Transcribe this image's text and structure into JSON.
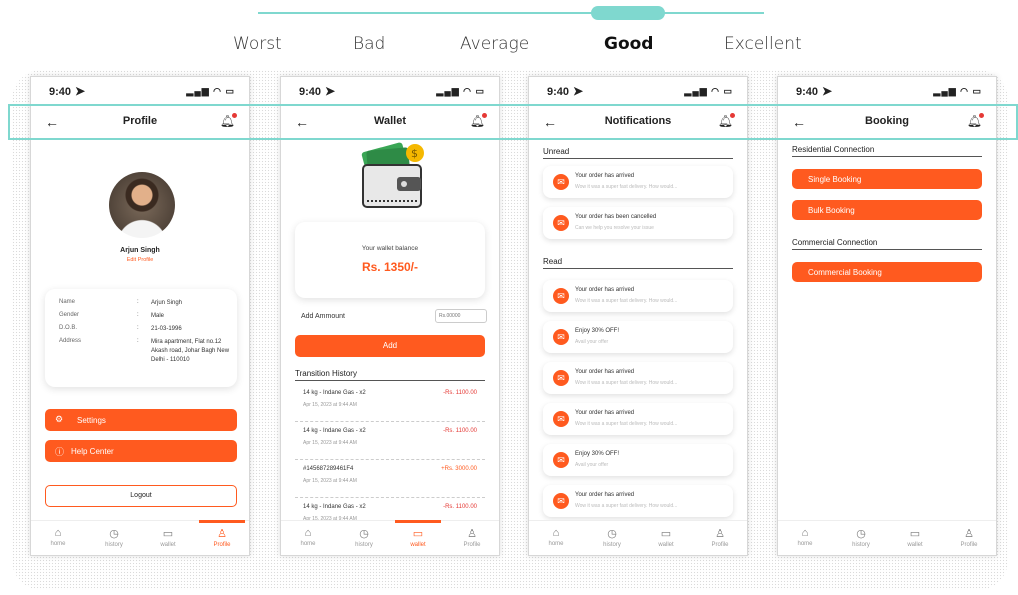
{
  "scale": {
    "labels": [
      "Worst",
      "Bad",
      "Average",
      "Good",
      "Excellent"
    ],
    "selected": "Good"
  },
  "status": {
    "time": "9:40",
    "location_icon": "location-arrow-icon",
    "icons": "signal wifi battery"
  },
  "nav": {
    "back_icon": "arrow-left-icon",
    "bell_icon": "bell-icon"
  },
  "tabs": [
    "home",
    "history",
    "wallet",
    "Profile"
  ],
  "profile": {
    "title": "Profile",
    "name": "Arjun Singh",
    "edit": "Edit Profile",
    "details": [
      {
        "key": "Name",
        "value": "Arjun Singh"
      },
      {
        "key": "Gender",
        "value": "Male"
      },
      {
        "key": "D.O.B.",
        "value": "21-03-1996"
      },
      {
        "key": "Address",
        "value": "Mira apartment, Flat no.12 Akash road, Johar Bagh New Delhi - 110010"
      }
    ],
    "separator": ":",
    "settings": "Settings",
    "help": "Help Center",
    "logout": "Logout",
    "active_tab": "Profile"
  },
  "wallet": {
    "title": "Wallet",
    "balance_label": "Your wallet balance",
    "balance": "Rs. 1350/-",
    "add_amount_label": "Add Ammount",
    "amount_placeholder": "Rs.00000",
    "add_button": "Add",
    "history_title": "Transition History",
    "transactions": [
      {
        "title": "14 kg - Indane Gas - x2",
        "date": "Apr 15, 2023 at 9:44 AM",
        "amount": "-Rs. 1100.00",
        "type": "debit"
      },
      {
        "title": "14 kg - Indane Gas - x2",
        "date": "Apr 15, 2023 at 9:44 AM",
        "amount": "-Rs. 1100.00",
        "type": "debit"
      },
      {
        "title": "#145687289461F4",
        "date": "Apr 15, 2023 at 9:44 AM",
        "amount": "+Rs. 3000.00",
        "type": "credit"
      },
      {
        "title": "14 kg - Indane Gas - x2",
        "date": "Apr 15, 2023 at 9:44 AM",
        "amount": "-Rs. 1100.00",
        "type": "debit"
      }
    ],
    "active_tab": "wallet"
  },
  "notifications": {
    "title": "Notifications",
    "unread_title": "Unread",
    "read_title": "Read",
    "unread": [
      {
        "title": "Your order has arrived",
        "sub": "Wow it was a super fast delivery. How would..."
      },
      {
        "title": "Your order has been cancelled",
        "sub": "Can we help you resolve your issue"
      }
    ],
    "read": [
      {
        "title": "Your order has arrived",
        "sub": "Wow it was a super fast delivery. How would..."
      },
      {
        "title": "Enjoy 30% OFF!",
        "sub": "Avail your offer"
      },
      {
        "title": "Your order has arrived",
        "sub": "Wow it was a super fast delivery. How would..."
      },
      {
        "title": "Your order has arrived",
        "sub": "Wow it was a super fast delivery. How would..."
      },
      {
        "title": "Enjoy 30% OFF!",
        "sub": "Avail your offer"
      },
      {
        "title": "Your order has arrived",
        "sub": "Wow it was a super fast delivery. How would..."
      }
    ]
  },
  "booking": {
    "title": "Booking",
    "residential_title": "Residential Connection",
    "single": "Single Booking",
    "bulk": "Bulk Booking",
    "commercial_title": "Commercial Connection",
    "commercial": "Commercial Booking"
  },
  "colors": {
    "accent": "#ff5a1f",
    "teal": "#7fd8cf",
    "debit": "#e53935",
    "credit": "#ff5a1f"
  }
}
